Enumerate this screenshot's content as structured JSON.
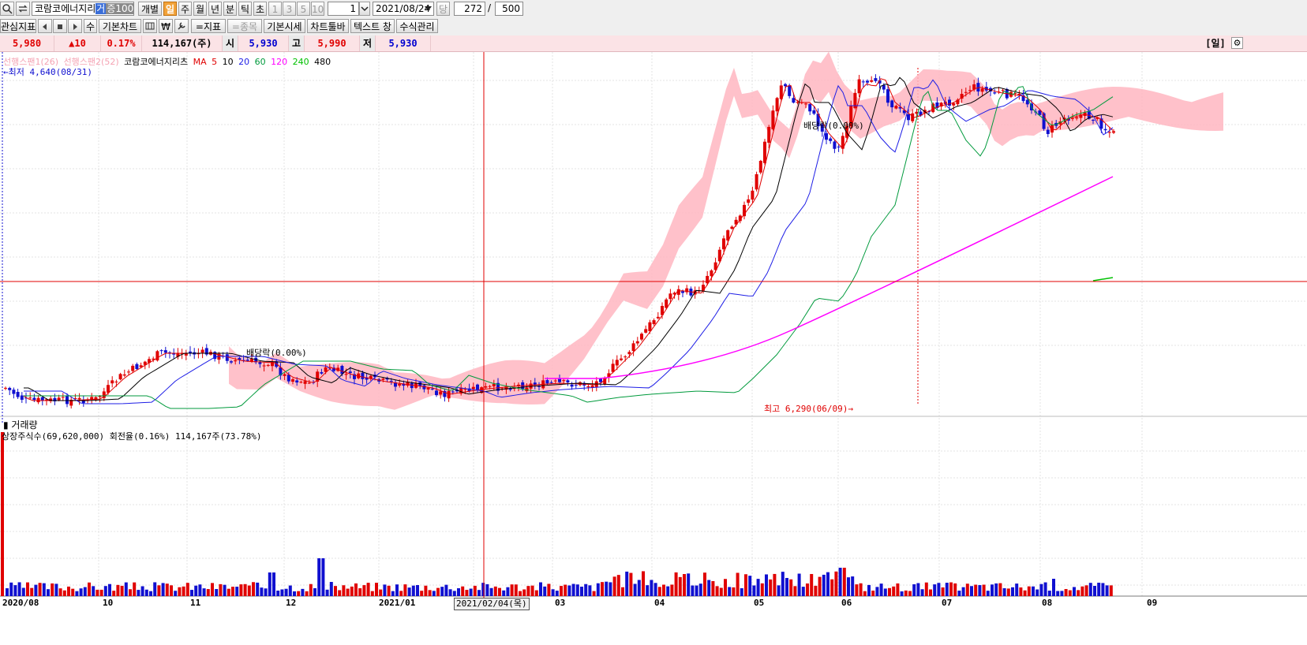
{
  "toolbar1": {
    "stock_name": "코람코에너지리",
    "tag_geo": "거",
    "tag_jeung": "증100",
    "btn_individual": "개별",
    "periods": [
      "일",
      "주",
      "월",
      "년",
      "분",
      "틱",
      "초"
    ],
    "period_selected": "일",
    "nums": [
      "1",
      "3",
      "5",
      "10"
    ],
    "interval_value": "1",
    "date_value": "2021/08/24",
    "date_btn": "당",
    "count_value": "272",
    "slash": "/",
    "total_value": "500"
  },
  "toolbar2": {
    "watchlist": "관심지표",
    "su": "수",
    "basic_chart": "기본차트",
    "won": "₩",
    "indicator": "=지표",
    "stocks": "=종목",
    "basic_quote": "기본시세",
    "chart_toolbar": "차트툴바",
    "text_window": "텍스트 창",
    "formula_mgmt": "수식관리"
  },
  "quote": {
    "price": "5,980",
    "change": "▲10",
    "change_pct": "0.17%",
    "volume": "114,167(주)",
    "open_label": "시",
    "open": "5,930",
    "high_label": "고",
    "high": "5,990",
    "low_label": "저",
    "low": "5,930",
    "period_tag": "[일]"
  },
  "legend": {
    "span1": "선행스팬1(26)",
    "span2": "선행스팬2(52)",
    "stock": "코람코에너지리츠",
    "ma_label": "MA",
    "ma5": "5",
    "ma10": "10",
    "ma20": "20",
    "ma60": "60",
    "ma120": "120",
    "ma240": "240",
    "ma480": "480"
  },
  "annotations": {
    "low": "←최저 4,640(08/31)",
    "high": "최고 6,290(06/09)→",
    "dividend1": "배당락(0.00%)",
    "dividend2": "배당락(0.00%)"
  },
  "volume_panel": {
    "title": "거래량",
    "info": "상장주식수(69,620,000) 회전율(0.16%) 114,167주(73.78%)"
  },
  "x_axis": {
    "labels": [
      "2020/08",
      "10",
      "11",
      "12",
      "2021/01",
      "03",
      "04",
      "05",
      "06",
      "07",
      "08",
      "09"
    ],
    "cursor_date": "2021/02/04(목)"
  },
  "colors": {
    "up": "#e00000",
    "down": "#1010d0",
    "ma5": "#e00000",
    "ma10": "#000000",
    "ma20": "#1e1ee6",
    "ma60": "#009a3c",
    "ma120": "#ff00ff",
    "ma240": "#00c000",
    "cloud": "#ffb6c1"
  },
  "chart_data": {
    "type": "candlestick",
    "period": "daily",
    "visible_high": {
      "price": 6290,
      "date": "06/09"
    },
    "visible_low": {
      "price": 4640,
      "date": "08/31"
    },
    "last": {
      "price": 5980,
      "open": 5930,
      "high": 5990,
      "low": 5930,
      "volume": 114167
    },
    "series": [
      "MA 5",
      "MA 10",
      "MA 20",
      "MA 60",
      "MA 120",
      "MA 240",
      "MA 480"
    ],
    "grid": true
  }
}
